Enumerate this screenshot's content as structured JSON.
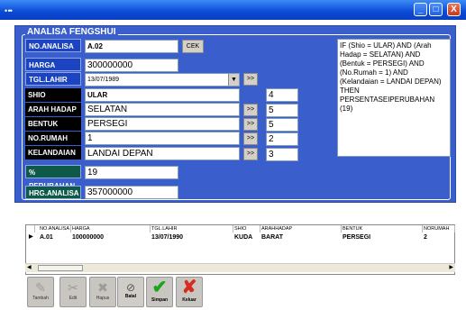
{
  "window": {
    "title_icon": "• ••",
    "minimize": "_",
    "maximize": "□",
    "close": "X"
  },
  "group": {
    "title": "ANALISA FENGSHUI"
  },
  "form": {
    "no_analisa": {
      "label": "NO.ANALISA",
      "value": "A.02",
      "button": "CEK"
    },
    "harga": {
      "label": "HARGA",
      "value": "300000000"
    },
    "tgl_lahir": {
      "label": "TGL.LAHIR",
      "value": "13/07/1989",
      "button": ">>"
    },
    "shio": {
      "label": "SHIO",
      "value": "ULAR",
      "score": "4"
    },
    "arah_hadap": {
      "label": "ARAH HADAP",
      "value": "SELATAN",
      "button": ">>",
      "score": "5"
    },
    "bentuk": {
      "label": "BENTUK",
      "value": "PERSEGI",
      "button": ">>",
      "score": "5"
    },
    "no_rumah": {
      "label": "NO.RUMAH",
      "value": "1",
      "button": ">>",
      "score": "2"
    },
    "kelandaian": {
      "label": "KELANDAIAN",
      "value": "LANDAI DEPAN",
      "button": ">>",
      "score": "3"
    },
    "perubahan": {
      "label": "% PERUBAHAN",
      "value": "19"
    },
    "hrg_analisa": {
      "label": "HRG.ANALISA",
      "value": "357000000"
    }
  },
  "rule_text": "IF (Shio = ULAR) AND (Arah\nHadap = SELATAN) AND\n(Bentuk = PERSEGI) AND\n(No.Rumah = 1) AND\n(Kelandaian = LANDAI DEPAN)\nTHEN\nPERSENTASEIPERUBAHAN\n(19)",
  "grid": {
    "headers": [
      "NO.ANALISA",
      "HARGA",
      "TGL.LAHIR",
      "SHIO",
      "ARAHHADAP",
      "BENTUK",
      "NORUMAH"
    ],
    "rows": [
      [
        "A.01",
        "100000000",
        "13/07/1990",
        "KUDA",
        "BARAT",
        "PERSEGI",
        "2"
      ]
    ]
  },
  "toolbar": {
    "tambah": "Tambah",
    "edit": "Edit",
    "hapus": "Hapus",
    "batal": "Batal",
    "simpan": "Simpan",
    "keluar": "Keluar"
  },
  "colors": {
    "panel_blue": "#3a5fcd",
    "title_blue": "#0a4ad7",
    "label_blue": "#1c44c0",
    "label_green": "#0e5a49"
  }
}
